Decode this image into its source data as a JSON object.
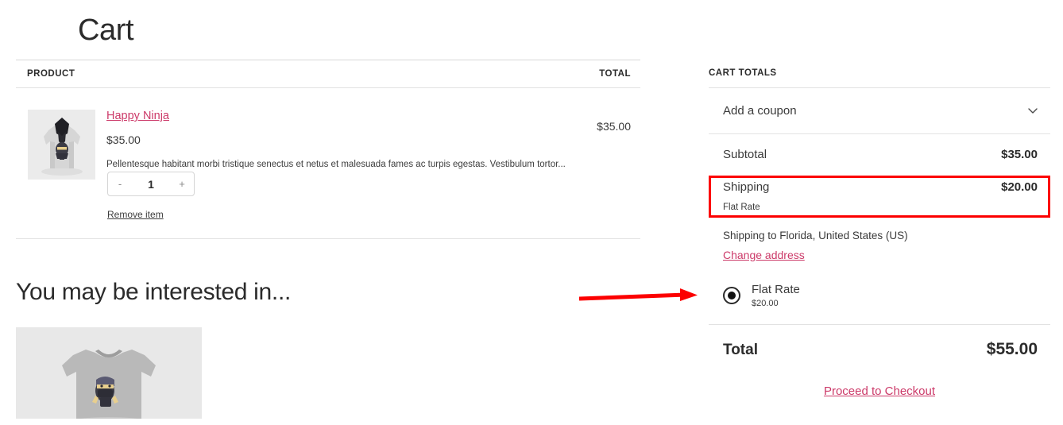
{
  "page": {
    "title": "Cart"
  },
  "cart_table": {
    "columns": {
      "product": "PRODUCT",
      "total": "TOTAL"
    },
    "rows": [
      {
        "name": "Happy Ninja",
        "price": "$35.00",
        "description": "Pellentesque habitant morbi tristique senectus et netus et malesuada fames ac turpis egestas. Vestibulum tortor...",
        "quantity": "1",
        "decrease_label": "-",
        "increase_label": "+",
        "remove_label": "Remove item",
        "line_total": "$35.00",
        "thumb_icon": "hoodie-product-image"
      }
    ]
  },
  "upsell": {
    "title": "You may be interested in...",
    "items": [
      {
        "thumb_icon": "tshirt-product-image"
      }
    ]
  },
  "totals": {
    "heading": "CART TOTALS",
    "coupon": {
      "label": "Add a coupon",
      "toggle_icon": "chevron-down-icon"
    },
    "subtotal": {
      "label": "Subtotal",
      "value": "$35.00"
    },
    "shipping": {
      "label": "Shipping",
      "value": "$20.00",
      "method": "Flat Rate",
      "highlighted": true,
      "highlight_color": "#fc0000"
    },
    "shipping_to": "Shipping to Florida, United States (US)",
    "change_address_label": "Change address",
    "shipping_options": [
      {
        "label": "Flat Rate",
        "price": "$20.00",
        "selected": true
      }
    ],
    "grand_total": {
      "label": "Total",
      "value": "$55.00"
    },
    "checkout_label": "Proceed to Checkout"
  },
  "annotation": {
    "arrow_icon": "red-arrow-pointing-right",
    "color": "#fc0000"
  },
  "colors": {
    "link": "#cc3a69",
    "text": "#2b2b2b",
    "annotation": "#fc0000",
    "divider": "#e2e2e2"
  }
}
